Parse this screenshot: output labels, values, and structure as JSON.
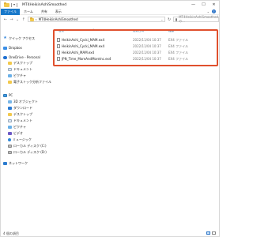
{
  "window": {
    "title": "MT4HeikinAshiSmoothed",
    "controls": {
      "minimize": "—",
      "maximize": "☐",
      "close": "✕"
    }
  },
  "ribbon": {
    "file_tab": "ファイル",
    "tabs": [
      "ホーム",
      "共有",
      "表示"
    ],
    "help": "?"
  },
  "address_bar": {
    "back": "←",
    "forward": "→",
    "up_history": "⌄",
    "up": "↑",
    "path_prefix": "«",
    "path_segment": "MT4HeikinAshiSmoothed",
    "dropdown": "⌄",
    "refresh": "↻",
    "search_placeholder": "MT4HeikinAshiSmoothedの..."
  },
  "sidebar": {
    "items": [
      {
        "label": "クイック アクセス",
        "icon": "star-icon"
      },
      {
        "label": "Dropbox",
        "icon": "dropbox-icon"
      },
      {
        "label": "OneDrive - Personal",
        "icon": "cloud-icon"
      },
      {
        "label": "デスクトップ",
        "icon": "folder-icon"
      },
      {
        "label": "ドキュメント",
        "icon": "document-icon"
      },
      {
        "label": "ピクチャ",
        "icon": "picture-icon"
      },
      {
        "label": "電子ストック分析ファイル",
        "icon": "folder-icon"
      },
      {
        "label": "PC",
        "icon": "pc-icon"
      },
      {
        "label": "3D オブジェクト",
        "icon": "cube-icon"
      },
      {
        "label": "ダウンロード",
        "icon": "download-icon"
      },
      {
        "label": "デスクトップ",
        "icon": "folder-icon"
      },
      {
        "label": "ドキュメント",
        "icon": "document-icon"
      },
      {
        "label": "ピクチャ",
        "icon": "picture-icon"
      },
      {
        "label": "ビデオ",
        "icon": "video-icon"
      },
      {
        "label": "ミュージック",
        "icon": "music-icon"
      },
      {
        "label": "ローカル ディスク (C:)",
        "icon": "drive-icon"
      },
      {
        "label": "ローカル ディスク (D:)",
        "icon": "drive-icon"
      },
      {
        "label": "ネットワーク",
        "icon": "network-icon"
      }
    ]
  },
  "columns": {
    "name": "名前",
    "date": "更新日時",
    "type": "種類"
  },
  "files": [
    {
      "name": "HeikinAshi_Cycki_MAM.ex4",
      "date": "2022/11/04 10:37",
      "type": "EX4 ファイル"
    },
    {
      "name": "HeikinAshi_Cycki_MAM.ex4",
      "date": "2022/11/04 10:37",
      "type": "EX4 ファイル"
    },
    {
      "name": "HeikinAshi_MAM.ex4",
      "date": "2022/11/04 10:37",
      "type": "EX4 ファイル"
    },
    {
      "name": "JPN_Time_MoreAndMorelnc.ex4",
      "date": "2022/11/04 10:37",
      "type": "EX4 ファイル"
    }
  ],
  "highlight_color": "#e0502d",
  "status": {
    "item_count": "4 個の項目"
  }
}
